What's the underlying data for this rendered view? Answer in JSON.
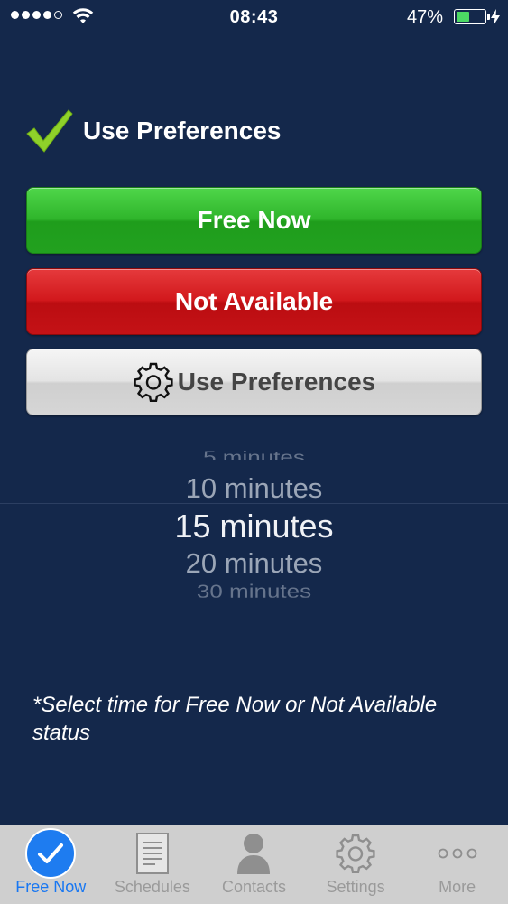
{
  "status_bar": {
    "time": "08:43",
    "battery_percent_label": "47%",
    "battery_level": 0.47,
    "signal_bars_filled": 4,
    "signal_bars_total": 5
  },
  "header": {
    "title": "Use Preferences",
    "icon": "checkmark-icon",
    "icon_color": "#8fd12a"
  },
  "buttons": {
    "free_now": "Free Now",
    "not_available": "Not Available",
    "use_preferences": "Use Preferences"
  },
  "picker": {
    "items": [
      "5 minutes",
      "10 minutes",
      "15 minutes",
      "20 minutes",
      "30 minutes"
    ],
    "selected": "15 minutes"
  },
  "footnote": "*Select time for Free Now or Not Available status",
  "tabs": [
    {
      "label": "Free Now",
      "icon": "checkmark-circle-icon",
      "active": true
    },
    {
      "label": "Schedules",
      "icon": "document-icon",
      "active": false
    },
    {
      "label": "Contacts",
      "icon": "person-icon",
      "active": false
    },
    {
      "label": "Settings",
      "icon": "gear-icon",
      "active": false
    },
    {
      "label": "More",
      "icon": "more-dots-icon",
      "active": false
    }
  ],
  "colors": {
    "background": "#14284b",
    "free_now": "#2fb52b",
    "not_available": "#d2181c",
    "tab_active": "#1877f2"
  }
}
